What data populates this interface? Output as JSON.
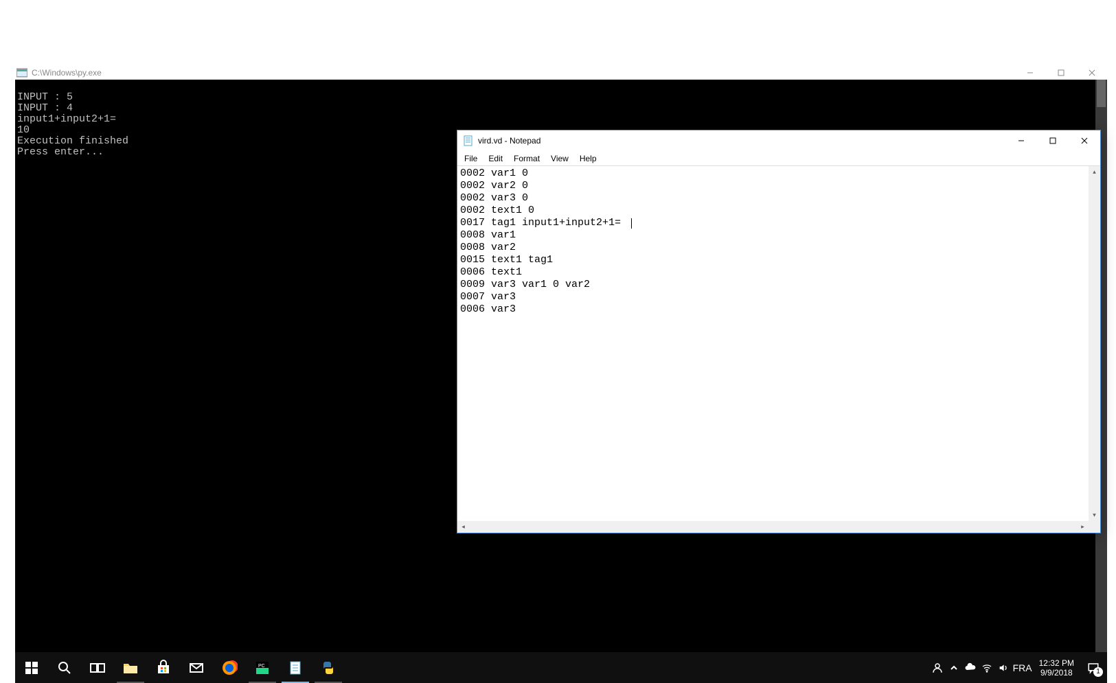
{
  "console": {
    "title": "C:\\Windows\\py.exe",
    "lines": [
      "INPUT : 5",
      "INPUT : 4",
      "input1+input2+1=",
      "10",
      "Execution finished",
      "Press enter..."
    ]
  },
  "notepad": {
    "title": "vird.vd - Notepad",
    "menus": {
      "file": "File",
      "edit": "Edit",
      "format": "Format",
      "view": "View",
      "help": "Help"
    },
    "lines": [
      "0002 var1 0",
      "0002 var2 0",
      "0002 var3 0",
      "0002 text1 0",
      "0017 tag1 input1+input2+1= ",
      "0008 var1",
      "0008 var2",
      "0015 text1 tag1",
      "0006 text1",
      "0009 var3 var1 0 var2",
      "0007 var3",
      "0006 var3"
    ],
    "cursor_line_index": 4
  },
  "taskbar": {
    "lang": "FRA",
    "time": "12:32 PM",
    "date": "9/9/2018",
    "notif_count": "1"
  }
}
